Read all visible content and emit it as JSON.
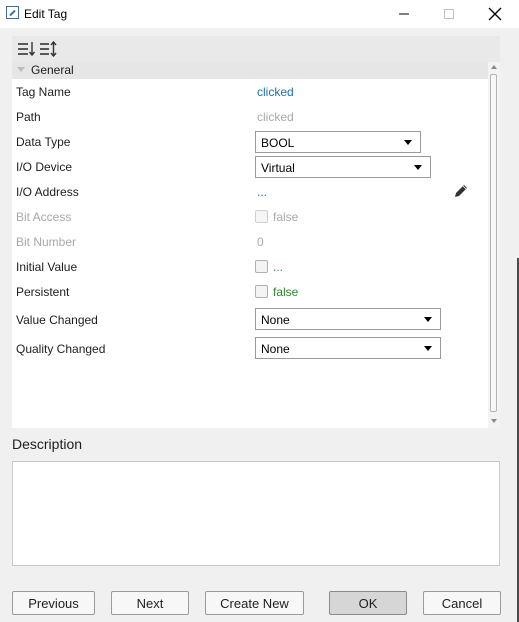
{
  "window": {
    "title": "Edit Tag",
    "minimize_icon": "minimize-icon",
    "maximize_icon": "maximize-icon",
    "close_icon": "close-icon"
  },
  "toolbar": {
    "icons": [
      "sort-categorized-icon",
      "sort-alphabetical-icon"
    ]
  },
  "category": {
    "label": "General"
  },
  "properties": {
    "tag_name": {
      "label": "Tag Name",
      "value": "clicked"
    },
    "path": {
      "label": "Path",
      "value": "clicked"
    },
    "data_type": {
      "label": "Data Type",
      "value": "BOOL"
    },
    "io_device": {
      "label": "I/O Device",
      "value": "Virtual"
    },
    "io_address": {
      "label": "I/O Address",
      "value": "...",
      "edit_icon": "pencil-icon"
    },
    "bit_access": {
      "label": "Bit Access",
      "value": "false"
    },
    "bit_number": {
      "label": "Bit Number",
      "value": "0"
    },
    "initial_value": {
      "label": "Initial Value",
      "value": "..."
    },
    "persistent": {
      "label": "Persistent",
      "value": "false"
    },
    "value_changed": {
      "label": "Value Changed",
      "value": "None"
    },
    "quality_changed": {
      "label": "Quality Changed",
      "value": "None"
    }
  },
  "description": {
    "label": "Description",
    "value": ""
  },
  "buttons": {
    "previous": "Previous",
    "next": "Next",
    "create_new": "Create New",
    "ok": "OK",
    "cancel": "Cancel"
  },
  "colors": {
    "link": "#1f6fb5",
    "green": "#2a8a2a",
    "disabled": "#a8a8a8"
  }
}
